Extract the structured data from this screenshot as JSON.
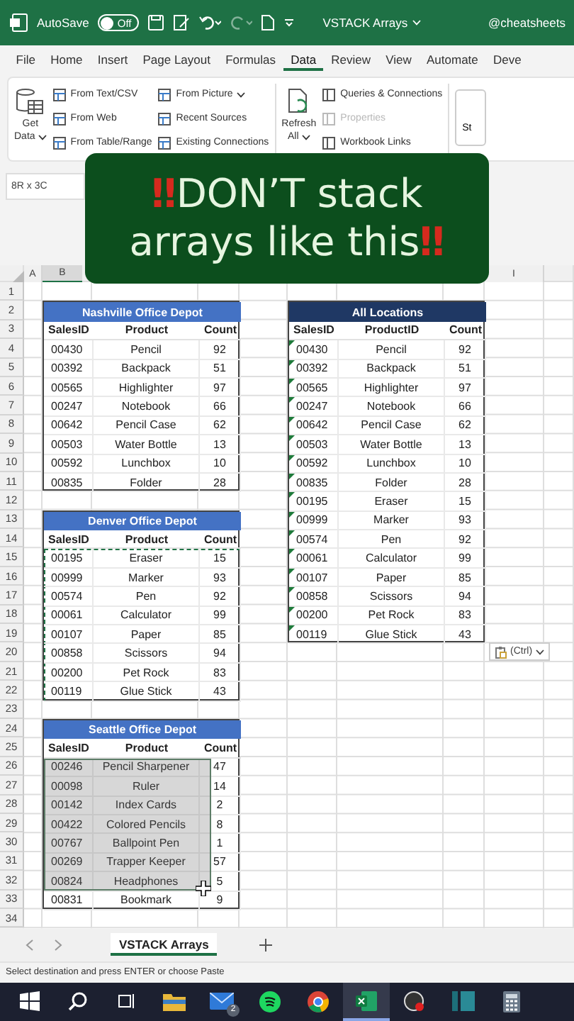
{
  "title_bar": {
    "autosave_label": "AutoSave",
    "autosave": {
      "on": false,
      "label": "Off"
    },
    "file_name": "VSTACK Arrays",
    "handle": "@cheatsheets"
  },
  "menu_tabs": [
    {
      "label": "File",
      "selected": false
    },
    {
      "label": "Home",
      "selected": false
    },
    {
      "label": "Insert",
      "selected": false
    },
    {
      "label": "Page Layout",
      "selected": false
    },
    {
      "label": "Formulas",
      "selected": false
    },
    {
      "label": "Data",
      "selected": true
    },
    {
      "label": "Review",
      "selected": false
    },
    {
      "label": "View",
      "selected": false
    },
    {
      "label": "Automate",
      "selected": false
    },
    {
      "label": "Deve",
      "selected": false
    }
  ],
  "ribbon": {
    "get_data": {
      "line_1": "Get",
      "line_2": "Data"
    },
    "import_columns": [
      [
        {
          "label": "From Text/CSV",
          "disabled": false,
          "dropdown": false
        },
        {
          "label": "From Web",
          "disabled": false,
          "dropdown": false
        },
        {
          "label": "From Table/Range",
          "disabled": false,
          "dropdown": false
        }
      ],
      [
        {
          "label": "From Picture",
          "disabled": false,
          "dropdown": true
        },
        {
          "label": "Recent Sources",
          "disabled": false,
          "dropdown": false
        },
        {
          "label": "Existing Connections",
          "disabled": false,
          "dropdown": false
        }
      ]
    ],
    "refresh": {
      "line_1": "Refresh",
      "line_2": "All"
    },
    "query_items": [
      {
        "label": "Queries & Connections",
        "disabled": false,
        "dropdown": false
      },
      {
        "label": "Properties",
        "disabled": true,
        "dropdown": false
      },
      {
        "label": "Workbook Links",
        "disabled": false,
        "dropdown": false
      }
    ],
    "cut_button": "St"
  },
  "name_box": "8R x 3C",
  "banner": {
    "lead_mark": "‼",
    "line_1": "DON’T stack",
    "line_2": "arrays like this",
    "trail_mark": "‼"
  },
  "column_headers": [
    "A",
    "B",
    "I"
  ],
  "row_numbers": [
    "1",
    "2",
    "3",
    "4",
    "5",
    "6",
    "7",
    "8",
    "9",
    "10",
    "11",
    "12",
    "13",
    "14",
    "15",
    "16",
    "17",
    "18",
    "19",
    "20",
    "21",
    "22",
    "23",
    "24",
    "25",
    "26",
    "27",
    "28",
    "29",
    "30",
    "31",
    "32",
    "33",
    "34"
  ],
  "tables": [
    {
      "title": "Nashville Office Depot",
      "color": "#4472c4",
      "copied": false,
      "dragging": false,
      "columns": [
        "SalesID",
        "Product",
        "Count"
      ],
      "rows": [
        [
          "00430",
          "Pencil",
          "92"
        ],
        [
          "00392",
          "Backpack",
          "51"
        ],
        [
          "00565",
          "Highlighter",
          "97"
        ],
        [
          "00247",
          "Notebook",
          "66"
        ],
        [
          "00642",
          "Pencil Case",
          "62"
        ],
        [
          "00503",
          "Water Bottle",
          "13"
        ],
        [
          "00592",
          "Lunchbox",
          "10"
        ],
        [
          "00835",
          "Folder",
          "28"
        ]
      ]
    },
    {
      "title": "Denver Office Depot",
      "color": "#4472c4",
      "copied": true,
      "dragging": false,
      "columns": [
        "SalesID",
        "Product",
        "Count"
      ],
      "rows": [
        [
          "00195",
          "Eraser",
          "15"
        ],
        [
          "00999",
          "Marker",
          "93"
        ],
        [
          "00574",
          "Pen",
          "92"
        ],
        [
          "00061",
          "Calculator",
          "99"
        ],
        [
          "00107",
          "Paper",
          "85"
        ],
        [
          "00858",
          "Scissors",
          "94"
        ],
        [
          "00200",
          "Pet Rock",
          "83"
        ],
        [
          "00119",
          "Glue Stick",
          "43"
        ]
      ]
    },
    {
      "title": "Seattle Office Depot",
      "color": "#4472c4",
      "copied": false,
      "dragging": true,
      "columns": [
        "SalesID",
        "Product",
        "Count"
      ],
      "rows": [
        [
          "00246",
          "Pencil Sharpener",
          "47"
        ],
        [
          "00098",
          "Ruler",
          "14"
        ],
        [
          "00142",
          "Index Cards",
          "2"
        ],
        [
          "00422",
          "Colored Pencils",
          "8"
        ],
        [
          "00767",
          "Ballpoint Pen",
          "1"
        ],
        [
          "00269",
          "Trapper Keeper",
          "57"
        ],
        [
          "00824",
          "Headphones",
          "5"
        ],
        [
          "00831",
          "Bookmark",
          "9"
        ]
      ]
    }
  ],
  "stacked_table": {
    "title": "All Locations",
    "color": "#1f3864",
    "text_flags": true,
    "columns": [
      "SalesID",
      "ProductID",
      "Count"
    ],
    "groups": [
      [
        [
          "00430",
          "Pencil",
          "92"
        ],
        [
          "00392",
          "Backpack",
          "51"
        ],
        [
          "00565",
          "Highlighter",
          "97"
        ],
        [
          "00247",
          "Notebook",
          "66"
        ],
        [
          "00642",
          "Pencil Case",
          "62"
        ],
        [
          "00503",
          "Water Bottle",
          "13"
        ],
        [
          "00592",
          "Lunchbox",
          "10"
        ],
        [
          "00835",
          "Folder",
          "28"
        ]
      ],
      [
        [
          "00195",
          "Eraser",
          "15"
        ],
        [
          "00999",
          "Marker",
          "93"
        ],
        [
          "00574",
          "Pen",
          "92"
        ],
        [
          "00061",
          "Calculator",
          "99"
        ],
        [
          "00107",
          "Paper",
          "85"
        ],
        [
          "00858",
          "Scissors",
          "94"
        ],
        [
          "00200",
          "Pet Rock",
          "83"
        ],
        [
          "00119",
          "Glue Stick",
          "43"
        ]
      ]
    ]
  },
  "paste_options": {
    "label": "(Ctrl)"
  },
  "sheet_tabs": [
    {
      "label": "VSTACK Arrays",
      "selected": true
    }
  ],
  "status_bar": "Select destination and press ENTER or choose Paste",
  "taskbar": [
    {
      "kind": "start",
      "selected": false
    },
    {
      "kind": "search",
      "selected": false
    },
    {
      "kind": "taskview",
      "selected": false
    },
    {
      "kind": "folder",
      "selected": false
    },
    {
      "kind": "mail",
      "selected": false,
      "badge": "2"
    },
    {
      "kind": "music",
      "selected": false
    },
    {
      "kind": "browser",
      "selected": false
    },
    {
      "kind": "sheet",
      "selected": true
    },
    {
      "kind": "recorder",
      "selected": false
    },
    {
      "kind": "panel",
      "selected": false
    },
    {
      "kind": "calculator",
      "selected": false
    }
  ]
}
